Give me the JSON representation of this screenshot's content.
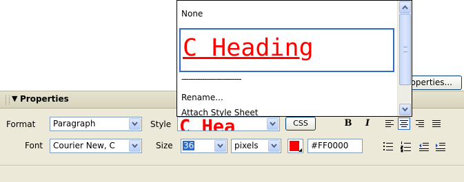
{
  "panel": {
    "title": "Properties",
    "format_label": "Format",
    "format_value": "Paragraph",
    "style_label": "Style",
    "style_value_preview": "C Hea",
    "css_button": "CSS",
    "bold_label": "B",
    "italic_label": "I",
    "font_label": "Font",
    "font_value": "Courier New, C",
    "size_label": "Size",
    "size_value": "36",
    "unit_value": "pixels",
    "color_hex": "#FF0000",
    "page_properties_button": "Page Properties..."
  },
  "style_dropdown": {
    "options": {
      "none": "None",
      "heading": "C Heading",
      "separator": "--------------------------",
      "rename": "Rename...",
      "attach": "Attach Style Sheet"
    }
  },
  "colors": {
    "text_color": "#ff0000",
    "selection_border": "#316ac5",
    "panel_bg": "#ece9d8"
  },
  "icons": [
    "collapse-arrow-icon",
    "align-left-icon",
    "align-center-icon",
    "align-right-icon",
    "align-justify-icon",
    "unordered-list-icon",
    "ordered-list-icon",
    "outdent-icon",
    "indent-icon",
    "scroll-up-icon",
    "scroll-down-icon",
    "chevron-down-icon"
  ]
}
